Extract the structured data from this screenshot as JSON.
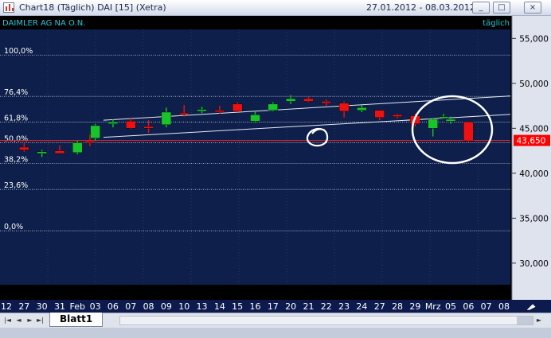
{
  "window": {
    "title": "Chart18 (Täglich)  DAI [15] (Xetra)",
    "date_range": "27.01.2012 - 08.03.2012",
    "buttons": [
      "_",
      "□",
      "×"
    ]
  },
  "chart": {
    "instrument": "DAIMLER AG NA O.N.",
    "period": "täglich",
    "price_label": "43,650",
    "colors": {
      "background": "#0d1f4a",
      "up": "#19c32a",
      "down": "#ee1111",
      "fib_line": "#c8cde0",
      "current_price": "#ff2020",
      "axis_text": "#000000",
      "instrument_text": "#27c7d9",
      "period_text": "#27c7d9",
      "price_box": "#ff0000"
    }
  },
  "chart_data": {
    "type": "candlestick",
    "y_axis_labels": [
      "55,000",
      "50,000",
      "45,000",
      "40,000",
      "35,000",
      "30,000"
    ],
    "ylim": [
      27.6,
      56.0
    ],
    "x_tick_labels": [
      "12",
      "27",
      "30",
      "31",
      "Feb",
      "03",
      "06",
      "07",
      "08",
      "09",
      "10",
      "13",
      "14",
      "15",
      "16",
      "17",
      "20",
      "21",
      "22",
      "23",
      "24",
      "27",
      "28",
      "29",
      "Mrz",
      "05",
      "06",
      "07",
      "08"
    ],
    "fibonacci_levels": [
      {
        "label": "100,0%",
        "value": 53.15
      },
      {
        "label": "76,4%",
        "value": 48.55
      },
      {
        "label": "61,8%",
        "value": 45.7
      },
      {
        "label": "50,0%",
        "value": 43.4
      },
      {
        "label": "38,2%",
        "value": 41.1
      },
      {
        "label": "23,6%",
        "value": 38.2
      },
      {
        "label": "0,0%",
        "value": 33.6
      }
    ],
    "current_price": 43.65,
    "candles": [
      {
        "date": "27",
        "open": 42.9,
        "high": 43.4,
        "low": 42.4,
        "close": 42.6
      },
      {
        "date": "30",
        "open": 42.2,
        "high": 42.6,
        "low": 41.8,
        "close": 42.4
      },
      {
        "date": "31",
        "open": 42.5,
        "high": 43.1,
        "low": 42.2,
        "close": 42.2
      },
      {
        "date": "01",
        "open": 42.3,
        "high": 43.6,
        "low": 42.1,
        "close": 43.4
      },
      {
        "date": "02",
        "open": 43.6,
        "high": 44.3,
        "low": 43.0,
        "close": 43.5
      },
      {
        "date": "03",
        "open": 43.9,
        "high": 45.5,
        "low": 43.6,
        "close": 45.3
      },
      {
        "date": "06",
        "open": 45.5,
        "high": 46.0,
        "low": 45.1,
        "close": 45.7
      },
      {
        "date": "07",
        "open": 45.8,
        "high": 46.2,
        "low": 44.9,
        "close": 45.0
      },
      {
        "date": "08",
        "open": 45.2,
        "high": 45.9,
        "low": 44.5,
        "close": 45.0
      },
      {
        "date": "09",
        "open": 45.4,
        "high": 47.3,
        "low": 45.1,
        "close": 46.8
      },
      {
        "date": "10",
        "open": 46.7,
        "high": 47.6,
        "low": 46.3,
        "close": 46.6
      },
      {
        "date": "13",
        "open": 46.9,
        "high": 47.4,
        "low": 46.7,
        "close": 47.1
      },
      {
        "date": "14",
        "open": 47.0,
        "high": 47.5,
        "low": 46.6,
        "close": 46.9
      },
      {
        "date": "15",
        "open": 47.7,
        "high": 47.9,
        "low": 46.8,
        "close": 46.9
      },
      {
        "date": "16",
        "open": 45.8,
        "high": 46.9,
        "low": 45.6,
        "close": 46.5
      },
      {
        "date": "17",
        "open": 47.0,
        "high": 47.9,
        "low": 46.9,
        "close": 47.7
      },
      {
        "date": "20",
        "open": 48.0,
        "high": 48.7,
        "low": 47.7,
        "close": 48.3
      },
      {
        "date": "21",
        "open": 48.3,
        "high": 48.5,
        "low": 47.9,
        "close": 48.0
      },
      {
        "date": "22",
        "open": 48.0,
        "high": 48.2,
        "low": 47.5,
        "close": 47.8
      },
      {
        "date": "23",
        "open": 47.8,
        "high": 48.0,
        "low": 46.2,
        "close": 46.9
      },
      {
        "date": "24",
        "open": 47.0,
        "high": 47.6,
        "low": 46.8,
        "close": 47.3
      },
      {
        "date": "27",
        "open": 47.0,
        "high": 47.0,
        "low": 45.9,
        "close": 46.2
      },
      {
        "date": "28",
        "open": 46.5,
        "high": 46.6,
        "low": 46.1,
        "close": 46.3
      },
      {
        "date": "29",
        "open": 46.4,
        "high": 46.6,
        "low": 45.2,
        "close": 45.5
      },
      {
        "date": "01",
        "open": 45.0,
        "high": 46.1,
        "low": 44.1,
        "close": 46.0
      },
      {
        "date": "02",
        "open": 46.3,
        "high": 46.6,
        "low": 46.1,
        "close": 46.3
      },
      {
        "date": "05",
        "open": 45.8,
        "high": 46.3,
        "low": 45.5,
        "close": 46.0
      },
      {
        "date": "06",
        "open": 45.7,
        "high": 45.7,
        "low": 43.4,
        "close": 43.6
      }
    ]
  },
  "tabs": {
    "sheet": "Blatt1",
    "nav": [
      "|◄",
      "◄",
      "►",
      "►|"
    ]
  }
}
